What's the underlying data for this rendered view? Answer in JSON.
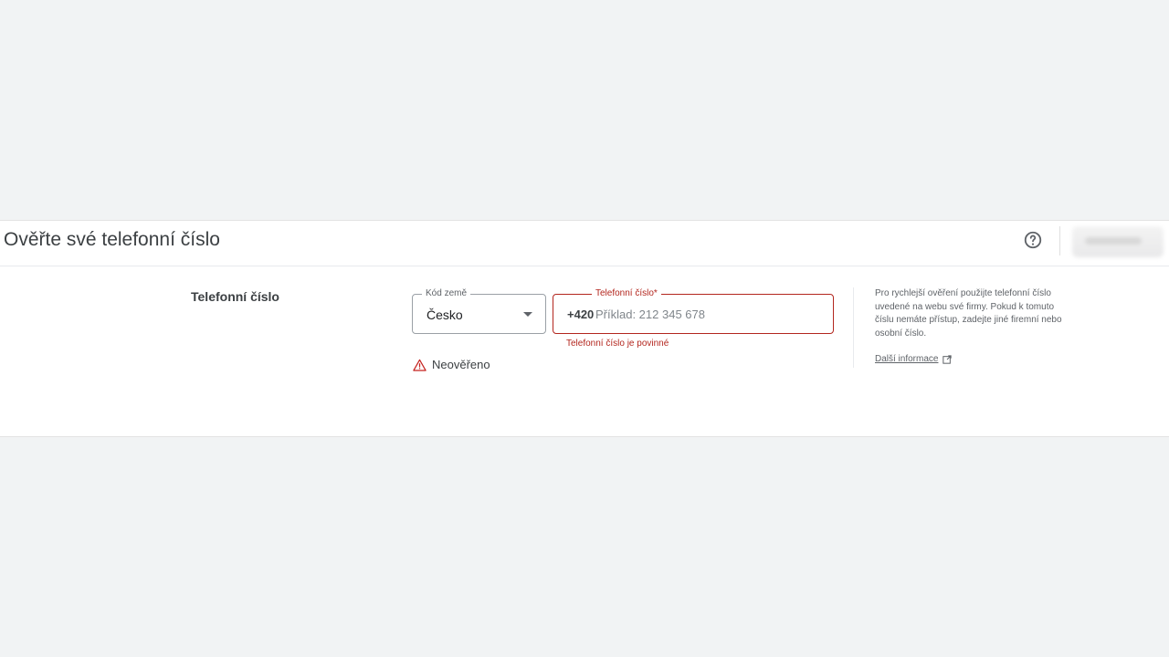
{
  "header": {
    "title": "Ověřte své telefonní číslo",
    "help_icon": "help-circle-icon"
  },
  "form": {
    "row_label": "Telefonní číslo",
    "country": {
      "legend": "Kód země",
      "value": "Česko",
      "icon": "dropdown-arrow-icon"
    },
    "phone": {
      "legend": "Telefonní číslo*",
      "prefix": "+420",
      "placeholder": "Příklad: 212 345 678",
      "value": "",
      "error": "Telefonní číslo je povinné"
    },
    "status": {
      "icon": "warning-icon",
      "text": "Neověřeno"
    }
  },
  "side_help": {
    "text": "Pro rychlejší ověření použijte telefonní číslo uvedené na webu své firmy. Pokud k tomuto číslu nemáte přístup, zadejte jiné firemní nebo osobní číslo.",
    "link_label": "Další informace",
    "link_icon": "external-link-icon"
  },
  "colors": {
    "error": "#b3261e",
    "background": "#f1f3f4",
    "card": "#ffffff"
  }
}
